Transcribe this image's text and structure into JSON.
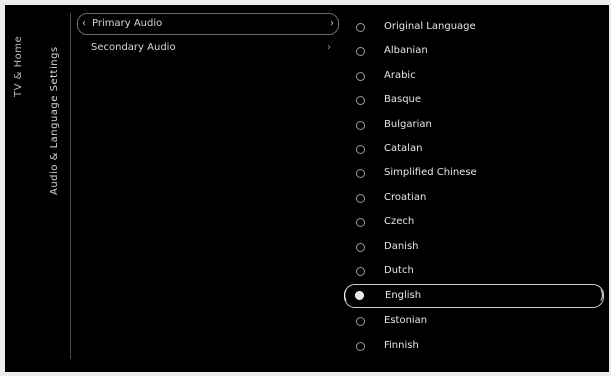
{
  "rail": {
    "title": "TV & Home",
    "section": "Audio & Language Settings"
  },
  "submenu": {
    "items": [
      {
        "label": "Primary Audio",
        "selected": true
      },
      {
        "label": "Secondary Audio",
        "selected": false
      }
    ]
  },
  "languages": {
    "items": [
      {
        "label": "Original Language",
        "selected": false
      },
      {
        "label": "Albanian",
        "selected": false
      },
      {
        "label": "Arabic",
        "selected": false
      },
      {
        "label": "Basque",
        "selected": false
      },
      {
        "label": "Bulgarian",
        "selected": false
      },
      {
        "label": "Catalan",
        "selected": false
      },
      {
        "label": "Simplified Chinese",
        "selected": false
      },
      {
        "label": "Croatian",
        "selected": false
      },
      {
        "label": "Czech",
        "selected": false
      },
      {
        "label": "Danish",
        "selected": false
      },
      {
        "label": "Dutch",
        "selected": false
      },
      {
        "label": "English",
        "selected": true
      },
      {
        "label": "Estonian",
        "selected": false
      },
      {
        "label": "Finnish",
        "selected": false
      }
    ]
  }
}
